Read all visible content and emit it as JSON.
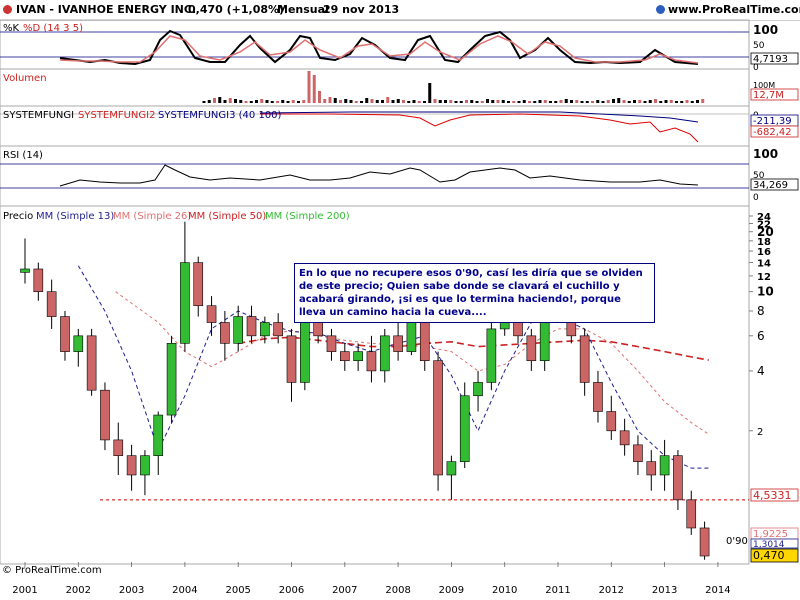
{
  "header": {
    "title": "IVAN - IVANHOE ENERGY INC.",
    "price": "0,470 (+1,08%)",
    "period": "Mensual",
    "date": "29 nov 2013",
    "site": "www.ProRealTime.com"
  },
  "footer": {
    "copyright": "© ProRealTime.com"
  },
  "note": {
    "text": "En lo que no recupere esos 0'90, casí les diría que se olviden de este precio; Quien sabe donde se clavará el cuchillo y acabará girando, ¡si es que lo termina haciendo!, porque lleva un camino hacia la cueva...."
  },
  "support_label": "0'90",
  "colors": {
    "up": "#33bb33",
    "down": "#cc6666",
    "sma13": "#1f1f8f",
    "sma26": "#e07070",
    "sma50": "#cc2222",
    "sma200": "#33cc33",
    "grid": "#000080"
  },
  "panels": {
    "stoch": {
      "label_k": "%K",
      "label_d": "%D (14 3 5)",
      "axis": [
        "100",
        "50",
        "0"
      ],
      "value": "4,7193"
    },
    "volume": {
      "label": "Volumen",
      "axis": [
        "100M"
      ],
      "value": "12,7M"
    },
    "fungi": {
      "label_1": "SYSTEMFUNGI",
      "label_2": "SYSTEMFUNGI2",
      "label_3": "SYSTEMFUNGI3 (40 100)",
      "axis": [
        "0"
      ],
      "value_1": "-211,39",
      "value_2": "-682,42"
    },
    "rsi": {
      "label": "RSI (14)",
      "axis": [
        "100",
        "50",
        "0"
      ],
      "value": "34,269"
    },
    "price": {
      "label": "Precio",
      "mm1": "MM (Simple 13)",
      "mm2": "MM (Simple 26)",
      "mm3": "MM (Simple 50)",
      "mm4": "MM (Simple 200)",
      "value_sma50": "4,5331",
      "value_sma26": "1,9225",
      "value_sma13": "1,3014",
      "value_last": "0,470"
    }
  },
  "chart_data": {
    "type": "candlestick",
    "title": "IVAN - IVANHOE ENERGY INC.",
    "x_ticks": [
      "2001",
      "2002",
      "2003",
      "2004",
      "2005",
      "2006",
      "2007",
      "2008",
      "2009",
      "2010",
      "2011",
      "2012",
      "2013",
      "2014"
    ],
    "y_ticks": [
      24,
      22,
      20,
      18,
      16,
      14,
      12,
      10,
      8,
      6,
      4,
      2
    ],
    "y_scale": "log",
    "support_level": 0.9,
    "ohlc": [
      [
        2001.0,
        12.5,
        18.5,
        11.0,
        13.0
      ],
      [
        2001.25,
        13.0,
        14.0,
        9.0,
        10.0
      ],
      [
        2001.5,
        10.0,
        11.5,
        6.5,
        7.5
      ],
      [
        2001.75,
        7.5,
        8.0,
        4.5,
        5.0
      ],
      [
        2002.0,
        5.0,
        6.5,
        4.2,
        6.0
      ],
      [
        2002.25,
        6.0,
        6.5,
        3.0,
        3.2
      ],
      [
        2002.5,
        3.2,
        3.5,
        1.6,
        1.8
      ],
      [
        2002.75,
        1.8,
        2.2,
        1.2,
        1.5
      ],
      [
        2003.0,
        1.5,
        1.7,
        1.0,
        1.2
      ],
      [
        2003.25,
        1.2,
        1.6,
        0.95,
        1.5
      ],
      [
        2003.5,
        1.5,
        2.5,
        1.2,
        2.4
      ],
      [
        2003.75,
        2.4,
        6.0,
        2.2,
        5.5
      ],
      [
        2004.0,
        5.5,
        22.5,
        5.0,
        14.0
      ],
      [
        2004.25,
        14.0,
        15.0,
        7.5,
        8.5
      ],
      [
        2004.5,
        8.5,
        9.5,
        6.0,
        7.0
      ],
      [
        2004.75,
        7.0,
        8.0,
        4.5,
        5.5
      ],
      [
        2005.0,
        5.5,
        8.5,
        5.0,
        7.5
      ],
      [
        2005.25,
        7.5,
        8.5,
        5.5,
        6.0
      ],
      [
        2005.5,
        6.0,
        7.5,
        5.5,
        7.0
      ],
      [
        2005.75,
        7.0,
        7.8,
        5.5,
        6.0
      ],
      [
        2006.0,
        6.0,
        6.5,
        2.8,
        3.5
      ],
      [
        2006.25,
        3.5,
        8.0,
        3.2,
        7.0
      ],
      [
        2006.5,
        7.0,
        7.5,
        5.5,
        6.0
      ],
      [
        2006.75,
        6.0,
        6.5,
        4.5,
        5.0
      ],
      [
        2007.0,
        5.0,
        5.5,
        4.0,
        4.5
      ],
      [
        2007.25,
        4.5,
        5.5,
        4.0,
        5.0
      ],
      [
        2007.5,
        5.0,
        6.0,
        3.5,
        4.0
      ],
      [
        2007.75,
        4.0,
        6.5,
        3.5,
        6.0
      ],
      [
        2008.0,
        6.0,
        7.0,
        4.5,
        5.0
      ],
      [
        2008.25,
        5.0,
        11.5,
        4.8,
        10.5
      ],
      [
        2008.5,
        10.5,
        11.0,
        4.0,
        4.5
      ],
      [
        2008.75,
        4.5,
        5.0,
        1.0,
        1.2
      ],
      [
        2009.0,
        1.2,
        1.5,
        0.9,
        1.4
      ],
      [
        2009.25,
        1.4,
        3.5,
        1.3,
        3.0
      ],
      [
        2009.5,
        3.0,
        4.0,
        2.5,
        3.5
      ],
      [
        2009.75,
        3.5,
        7.0,
        3.2,
        6.5
      ],
      [
        2010.0,
        6.5,
        11.0,
        6.0,
        10.0
      ],
      [
        2010.25,
        10.0,
        10.5,
        5.5,
        6.0
      ],
      [
        2010.5,
        6.0,
        6.5,
        4.0,
        4.5
      ],
      [
        2010.75,
        4.5,
        8.0,
        4.0,
        7.5
      ],
      [
        2011.0,
        7.5,
        11.0,
        7.0,
        10.0
      ],
      [
        2011.25,
        10.0,
        10.5,
        5.5,
        6.0
      ],
      [
        2011.5,
        6.0,
        6.5,
        3.0,
        3.5
      ],
      [
        2011.75,
        3.5,
        4.0,
        2.2,
        2.5
      ],
      [
        2012.0,
        2.5,
        3.0,
        1.8,
        2.0
      ],
      [
        2012.25,
        2.0,
        2.3,
        1.5,
        1.7
      ],
      [
        2012.5,
        1.7,
        1.9,
        1.2,
        1.4
      ],
      [
        2012.75,
        1.4,
        1.6,
        1.0,
        1.2
      ],
      [
        2013.0,
        1.2,
        1.8,
        1.0,
        1.5
      ],
      [
        2013.25,
        1.5,
        1.6,
        0.8,
        0.9
      ],
      [
        2013.5,
        0.9,
        1.0,
        0.6,
        0.65
      ],
      [
        2013.75,
        0.65,
        0.7,
        0.45,
        0.47
      ]
    ],
    "sma13": [
      [
        2002.0,
        13.5
      ],
      [
        2002.5,
        8.0
      ],
      [
        2003.0,
        4.0
      ],
      [
        2003.5,
        1.6
      ],
      [
        2004.0,
        3.0
      ],
      [
        2004.5,
        6.5
      ],
      [
        2005.0,
        8.0
      ],
      [
        2005.5,
        7.0
      ],
      [
        2006.0,
        6.3
      ],
      [
        2006.5,
        6.2
      ],
      [
        2007.0,
        5.5
      ],
      [
        2007.5,
        5.0
      ],
      [
        2008.0,
        5.5
      ],
      [
        2008.5,
        6.0
      ],
      [
        2009.0,
        3.8
      ],
      [
        2009.5,
        2.0
      ],
      [
        2010.0,
        4.0
      ],
      [
        2010.5,
        7.0
      ],
      [
        2011.0,
        7.5
      ],
      [
        2011.5,
        6.5
      ],
      [
        2012.0,
        3.5
      ],
      [
        2012.5,
        2.0
      ],
      [
        2013.0,
        1.5
      ],
      [
        2013.5,
        1.3
      ],
      [
        2013.83,
        1.3
      ]
    ],
    "sma26": [
      [
        2002.7,
        10.0
      ],
      [
        2003.5,
        7.0
      ],
      [
        2004.0,
        5.0
      ],
      [
        2004.5,
        4.2
      ],
      [
        2005.0,
        5.0
      ],
      [
        2005.5,
        6.0
      ],
      [
        2006.0,
        6.4
      ],
      [
        2006.5,
        6.0
      ],
      [
        2007.0,
        5.7
      ],
      [
        2007.5,
        5.5
      ],
      [
        2008.0,
        5.4
      ],
      [
        2008.5,
        5.3
      ],
      [
        2009.0,
        5.0
      ],
      [
        2009.5,
        4.0
      ],
      [
        2010.0,
        4.3
      ],
      [
        2010.5,
        5.5
      ],
      [
        2011.0,
        6.5
      ],
      [
        2011.5,
        6.5
      ],
      [
        2012.0,
        5.5
      ],
      [
        2012.5,
        4.0
      ],
      [
        2013.0,
        2.8
      ],
      [
        2013.5,
        2.2
      ],
      [
        2013.83,
        1.92
      ]
    ],
    "sma50": [
      [
        2005.0,
        5.5
      ],
      [
        2005.5,
        5.8
      ],
      [
        2006.0,
        5.9
      ],
      [
        2006.5,
        5.7
      ],
      [
        2007.0,
        5.5
      ],
      [
        2007.5,
        5.3
      ],
      [
        2008.0,
        5.3
      ],
      [
        2008.5,
        5.5
      ],
      [
        2009.0,
        5.6
      ],
      [
        2009.5,
        5.3
      ],
      [
        2010.0,
        5.4
      ],
      [
        2010.5,
        5.5
      ],
      [
        2011.0,
        5.6
      ],
      [
        2011.5,
        5.7
      ],
      [
        2012.0,
        5.6
      ],
      [
        2012.5,
        5.3
      ],
      [
        2013.0,
        5.0
      ],
      [
        2013.5,
        4.7
      ],
      [
        2013.83,
        4.53
      ]
    ],
    "indicators": {
      "stoch_k_last": 4.7193,
      "rsi_last": 34.269,
      "volume_last": "12,7M",
      "fungi_last": [
        -211.39,
        -682.42
      ]
    }
  }
}
